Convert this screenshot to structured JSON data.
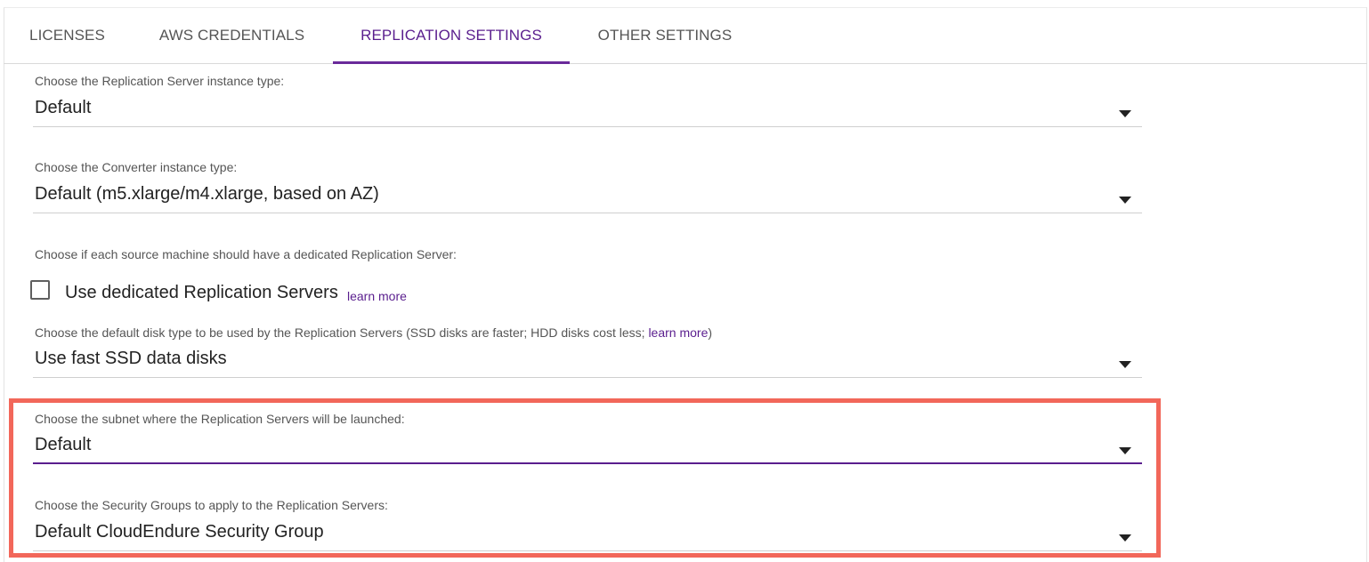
{
  "tabs": [
    {
      "label": "LICENSES",
      "active": false
    },
    {
      "label": "AWS CREDENTIALS",
      "active": false
    },
    {
      "label": "REPLICATION SETTINGS",
      "active": true
    },
    {
      "label": "OTHER SETTINGS",
      "active": false
    }
  ],
  "fields": {
    "replication_instance": {
      "label": "Choose the Replication Server instance type:",
      "value": "Default"
    },
    "converter_instance": {
      "label": "Choose the Converter instance type:",
      "value": "Default (m5.xlarge/m4.xlarge, based on AZ)"
    },
    "dedicated_servers": {
      "label": "Choose if each source machine should have a dedicated Replication Server:",
      "checkbox_label": "Use dedicated Replication Servers",
      "checked": false,
      "learn_more": "learn more"
    },
    "disk_type": {
      "label_prefix": "Choose the default disk type to be used by the Replication Servers (SSD disks are faster; HDD disks cost less; ",
      "learn_more": "learn more",
      "label_suffix": ")",
      "value": "Use fast SSD data disks"
    },
    "subnet": {
      "label": "Choose the subnet where the Replication Servers will be launched:",
      "value": "Default"
    },
    "security_groups": {
      "label": "Choose the Security Groups to apply to the Replication Servers:",
      "value": "Default CloudEndure Security Group"
    }
  },
  "colors": {
    "accent": "#5a1e8e",
    "highlight": "#f2675a"
  }
}
